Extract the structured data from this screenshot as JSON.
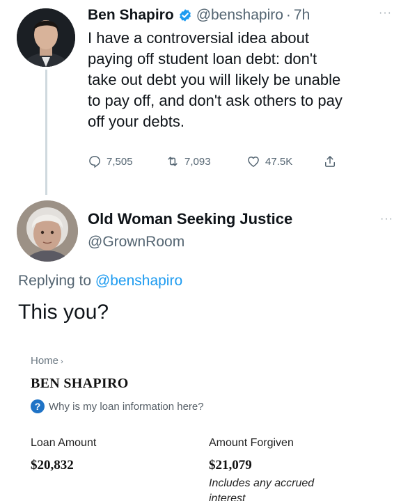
{
  "tweet1": {
    "name": "Ben Shapiro",
    "handle": "@benshapiro",
    "separator": "·",
    "time": "7h",
    "more": "···",
    "lines": [
      "I have a controversial idea about",
      "paying off student loan debt: don't",
      "take out debt you will likely be unable",
      "to pay off, and don't ask others to pay",
      "off your debts."
    ],
    "actions": {
      "replies": "7,505",
      "retweets": "7,093",
      "likes": "47.5K"
    }
  },
  "tweet2": {
    "name": "Old Woman Seeking Justice",
    "handle": "@GrownRoom",
    "more": "···",
    "replying_prefix": "Replying to ",
    "replying_handle": "@benshapiro",
    "text": "This you?"
  },
  "embed": {
    "breadcrumb": "Home",
    "breadcrumb_arrow": "›",
    "borrower": "BEN SHAPIRO",
    "help_icon": "?",
    "help_link": "Why is my loan information here?",
    "loan_amount_label": "Loan Amount",
    "loan_amount_value": "$20,832",
    "forgiven_label": "Amount Forgiven",
    "forgiven_value": "$21,079",
    "forgiven_note": "Includes any accrued interest"
  },
  "colors": {
    "link_blue": "#1d9bf0",
    "muted_gray": "#536471",
    "help_blue": "#1f73c6"
  }
}
